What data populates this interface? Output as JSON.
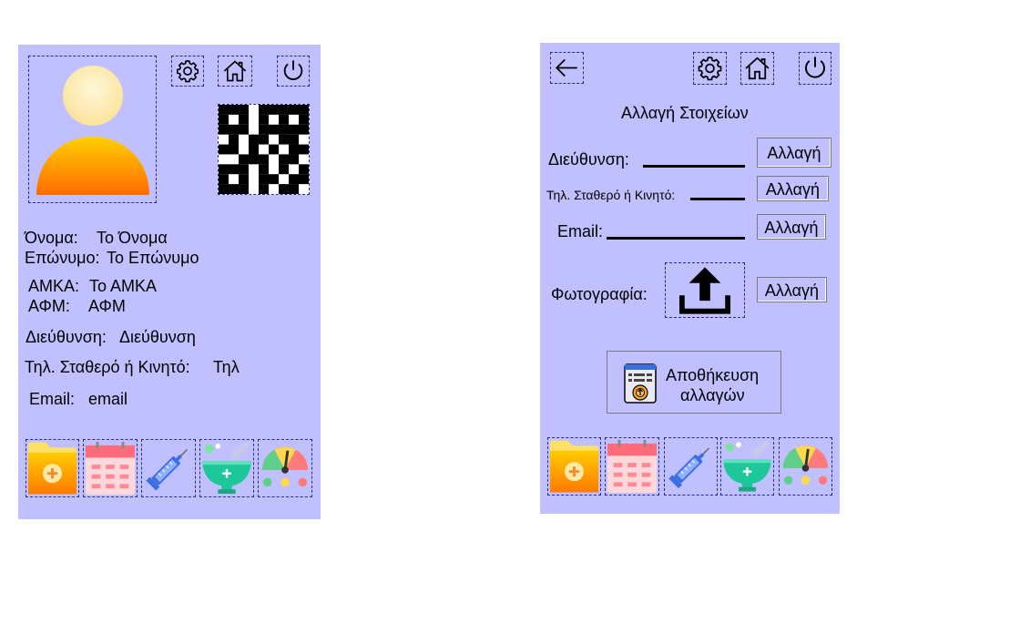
{
  "profile": {
    "name_label": "Όνομα:",
    "name_value": "Το Όνομα",
    "surname_label": "Επώνυμο:",
    "surname_value": "Το Επώνυμο",
    "amka_label": "ΑΜΚΑ:",
    "amka_value": "Το ΑΜΚΑ",
    "afm_label": "ΑΦΜ:",
    "afm_value": "ΑΦΜ",
    "address_label": "Διεύθυνση:",
    "address_value": "Διεύθυνση",
    "phone_label": "Τηλ. Σταθερό ή Κινητό:",
    "phone_value": "Τηλ",
    "email_label": "Email:",
    "email_value": "email"
  },
  "edit": {
    "title": "Αλλαγή Στοιχείων",
    "address_label": "Διεύθυνση:",
    "phone_label": "Τηλ. Σταθερό ή Κινητό:",
    "email_label": "Email:",
    "photo_label": "Φωτογραφία:",
    "change_label": "Αλλαγή",
    "save_label_line1": "Αποθήκευση",
    "save_label_line2": "αλλαγών"
  },
  "icons": {
    "header": [
      "gear-icon",
      "home-icon",
      "power-icon"
    ],
    "back": "back-arrow-icon",
    "bottom_nav": [
      "medical-folder-icon",
      "calendar-icon",
      "syringe-icon",
      "mortar-icon",
      "mood-gauge-icon"
    ]
  },
  "colors": {
    "screen_bg": "#c0c0ff",
    "avatar_head": "#fde9b0",
    "avatar_body_top": "#ffd000",
    "avatar_body_bottom": "#ff6a00"
  }
}
